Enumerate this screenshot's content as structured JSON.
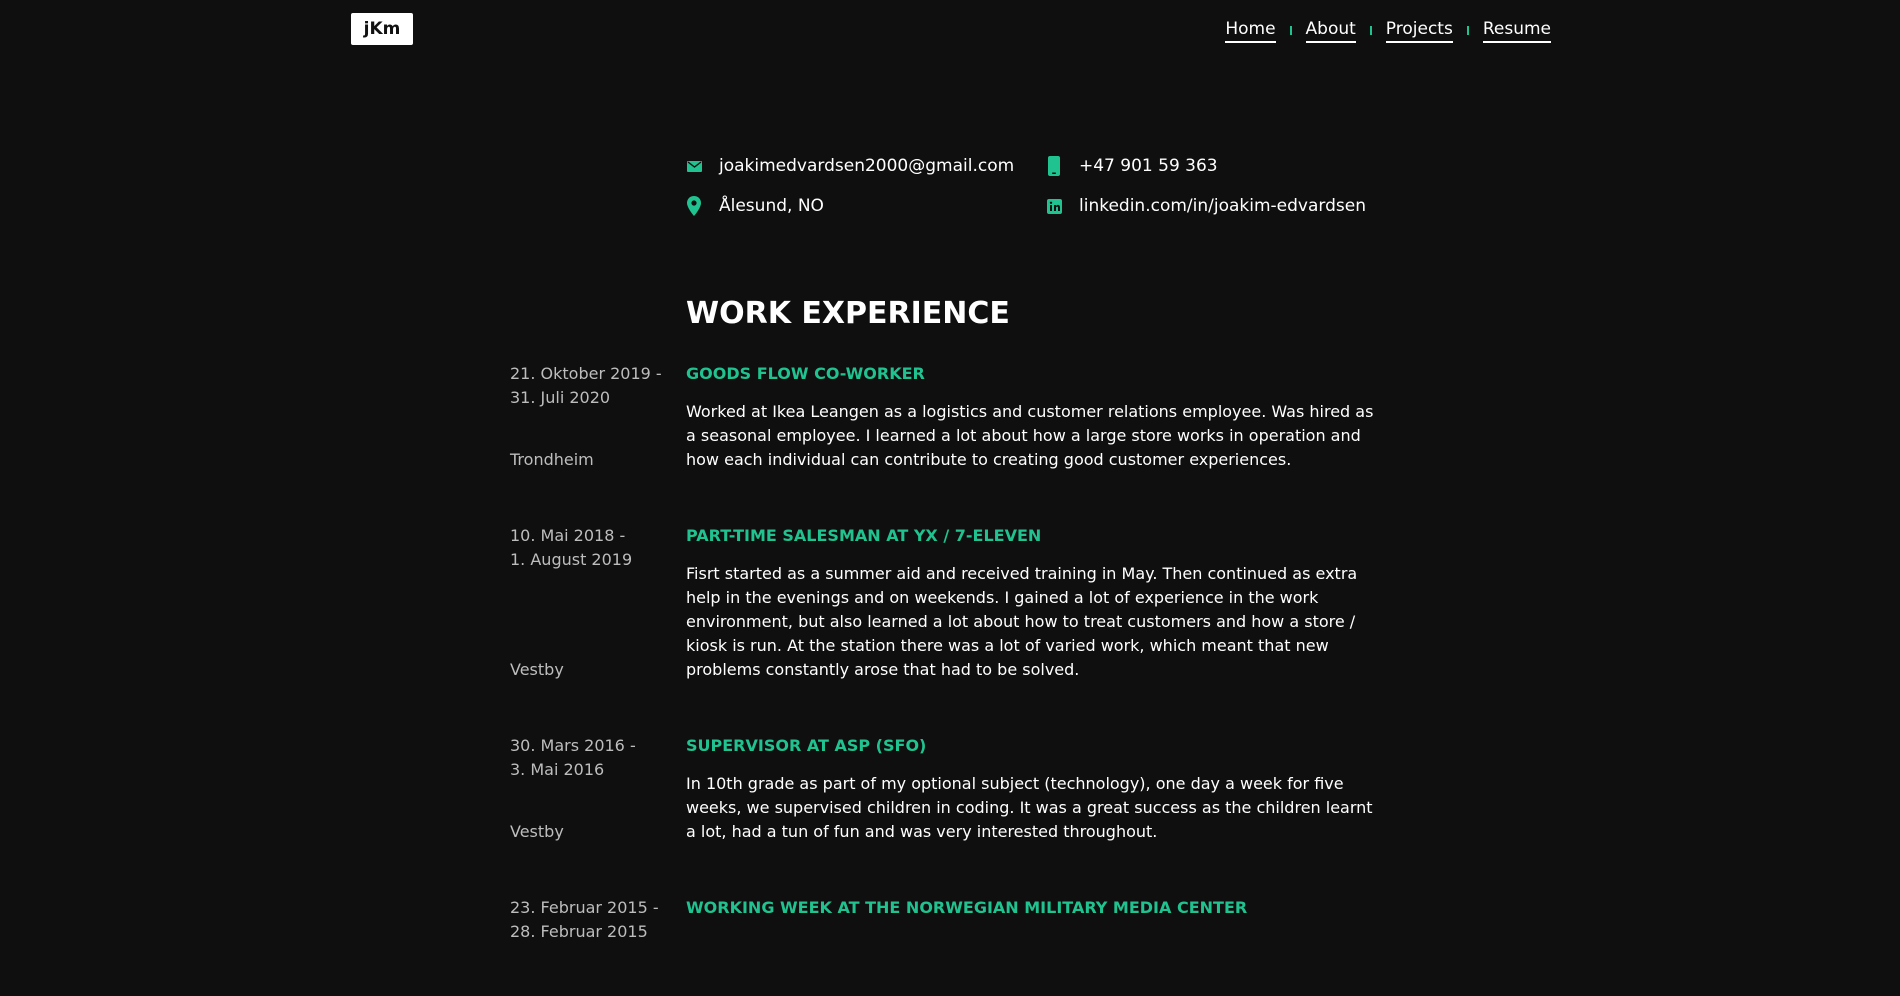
{
  "header": {
    "logo": "jKm",
    "nav": [
      "Home",
      "About",
      "Projects",
      "Resume"
    ]
  },
  "contact": {
    "email": "joakimedvardsen2000@gmail.com",
    "phone": "+47 901 59 363",
    "location": "Ålesund, NO",
    "linkedin": "linkedin.com/in/joakim-edvardsen"
  },
  "section_title": "WORK EXPERIENCE",
  "jobs": [
    {
      "date_start": "21. Oktober 2019 -",
      "date_end": "31. Juli 2020",
      "location": "Trondheim",
      "title": "GOODS FLOW CO-WORKER",
      "description": "Worked at Ikea Leangen as a logistics and customer relations employee. Was hired as a seasonal employee. I learned a lot about how a large store works in operation and how each individual can contribute to creating good customer experiences."
    },
    {
      "date_start": "10. Mai 2018 -",
      "date_end": "1. August 2019",
      "location": "Vestby",
      "title": "PART-TIME SALESMAN AT YX / 7-ELEVEN",
      "description": "Fisrt started as a summer aid and received training in May. Then continued as extra help in the evenings and on weekends. I gained a lot of experience in the work environment, but also learned a lot about how to treat customers and how a store / kiosk is run. At the station there was a lot of varied work, which meant that new problems constantly arose that had to be solved."
    },
    {
      "date_start": "30. Mars 2016 -",
      "date_end": "3. Mai 2016",
      "location": "Vestby",
      "title": "SUPERVISOR AT ASP (SFO)",
      "description": "In 10th grade as part of my optional subject (technology), one day a week for five weeks, we supervised children in coding. It was a great success as the children learnt a lot, had a tun of fun and was very interested throughout."
    },
    {
      "date_start": "23. Februar 2015 -",
      "date_end": "28. Februar 2015",
      "location": "",
      "title": "WORKING WEEK AT THE NORWEGIAN MILITARY MEDIA CENTER",
      "description": ""
    }
  ],
  "colors": {
    "accent": "#20c38f",
    "background": "#0f0f0f",
    "text": "#ffffff",
    "muted": "#bdbdbd"
  },
  "icons": [
    "envelope-icon",
    "phone-icon",
    "map-pin-icon",
    "linkedin-icon"
  ]
}
